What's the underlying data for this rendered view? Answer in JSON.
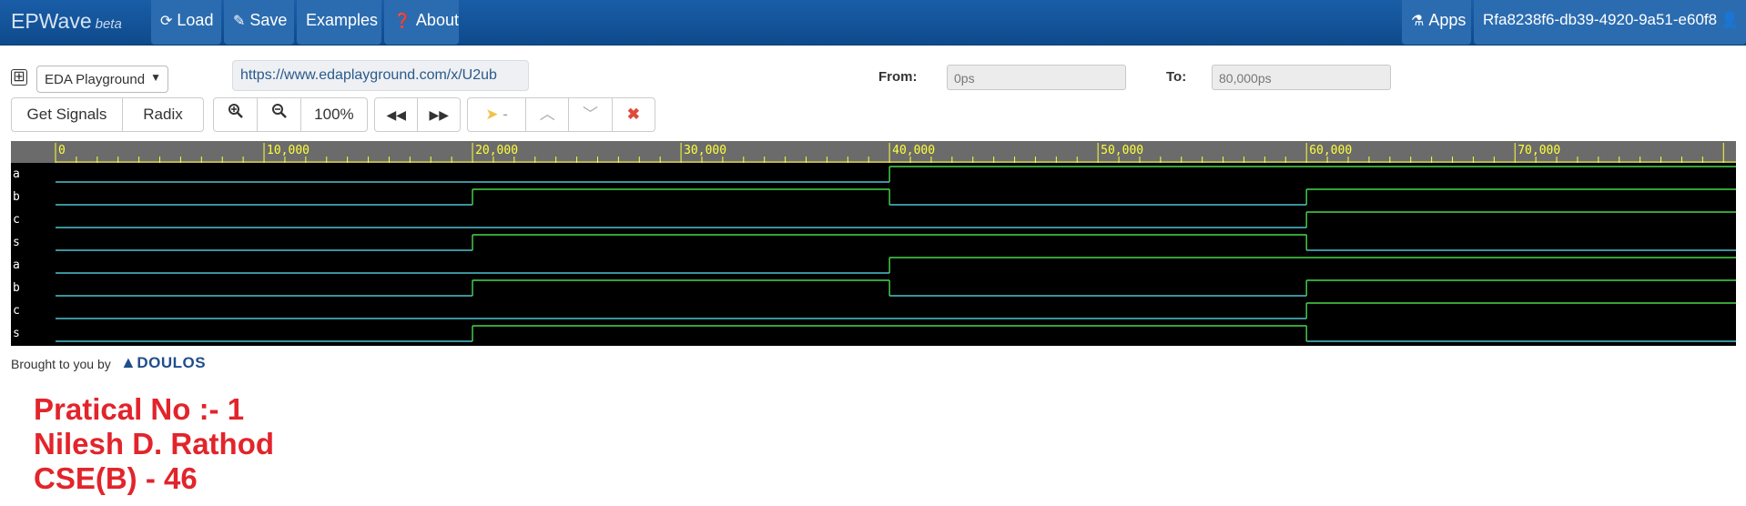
{
  "navbar": {
    "brand": "EPWave",
    "brand_suffix": "beta",
    "load": "Load",
    "save": "Save",
    "examples": "Examples",
    "about": "About",
    "apps": "Apps",
    "user": "Rfa8238f6-db39-4920-9a51-e60f8"
  },
  "toolbar": {
    "expand": "⊞",
    "source_select": "EDA Playground",
    "url": "https://www.edaplayground.com/x/U2ub",
    "from_label": "From:",
    "from_value": "0ps",
    "to_label": "To:",
    "to_value": "80,000ps",
    "get_signals": "Get Signals",
    "radix": "Radix",
    "zoom_level": "100%",
    "cursor_value": "-"
  },
  "waveform": {
    "time_start": 0,
    "time_end": 80000,
    "ruler_labels": [
      "0",
      "10,000",
      "20,000",
      "30,000",
      "40,000",
      "50,000",
      "60,000",
      "70,000"
    ],
    "signals": [
      {
        "name": "a",
        "transitions": [
          [
            0,
            0
          ],
          [
            40000,
            1
          ]
        ]
      },
      {
        "name": "b",
        "transitions": [
          [
            0,
            0
          ],
          [
            20000,
            1
          ],
          [
            40000,
            0
          ],
          [
            60000,
            1
          ]
        ]
      },
      {
        "name": "c",
        "transitions": [
          [
            0,
            0
          ],
          [
            60000,
            1
          ]
        ]
      },
      {
        "name": "s",
        "transitions": [
          [
            0,
            0
          ],
          [
            20000,
            1
          ],
          [
            60000,
            0
          ]
        ]
      },
      {
        "name": "a",
        "transitions": [
          [
            0,
            0
          ],
          [
            40000,
            1
          ]
        ]
      },
      {
        "name": "b",
        "transitions": [
          [
            0,
            0
          ],
          [
            20000,
            1
          ],
          [
            40000,
            0
          ],
          [
            60000,
            1
          ]
        ]
      },
      {
        "name": "c",
        "transitions": [
          [
            0,
            0
          ],
          [
            60000,
            1
          ]
        ]
      },
      {
        "name": "s",
        "transitions": [
          [
            0,
            0
          ],
          [
            20000,
            1
          ],
          [
            60000,
            0
          ]
        ]
      }
    ],
    "colors": {
      "low": "#4fc3d0",
      "high": "#49d84b",
      "ruler_text": "#ffff3a",
      "ruler_bg": "#6b6b6b"
    }
  },
  "footer": {
    "brought": "Brought to you by",
    "brand": "DOULOS"
  },
  "notes": {
    "line1": "Pratical No :- 1",
    "line2": "Nilesh D. Rathod",
    "line3": "CSE(B) - 46"
  }
}
